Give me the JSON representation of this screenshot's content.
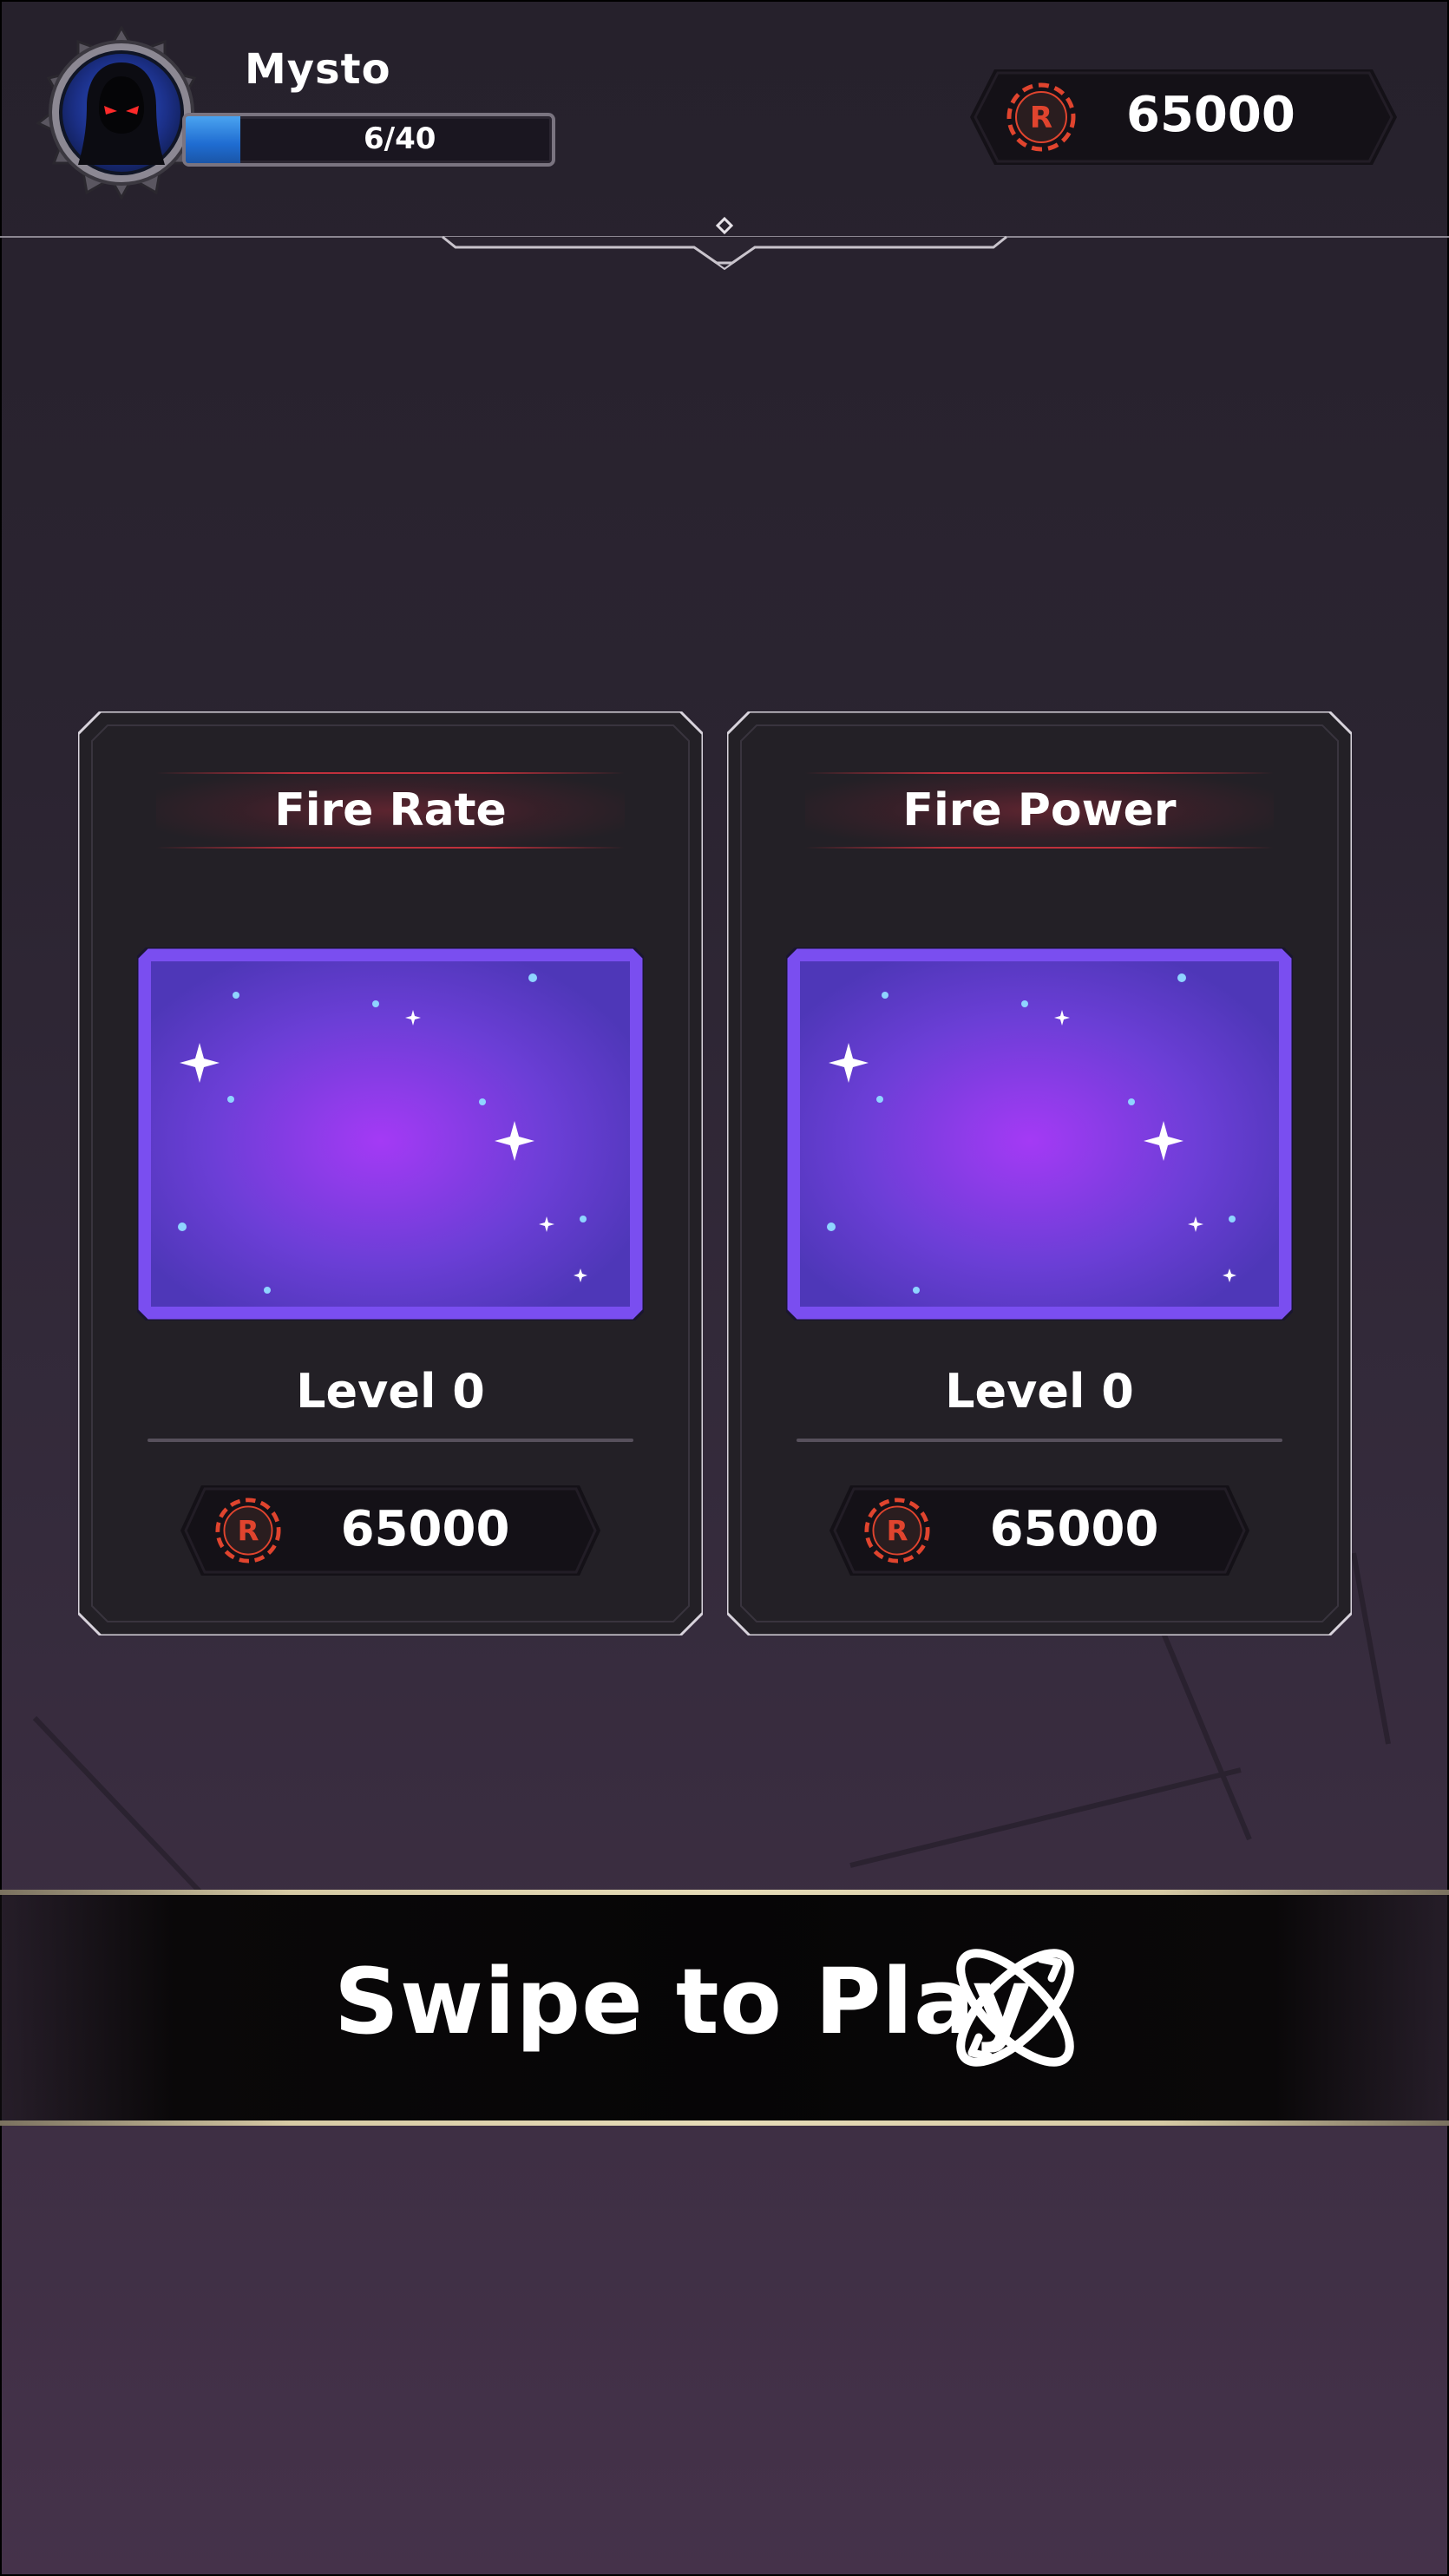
{
  "player": {
    "name": "Mysto",
    "xp_text": "6/40",
    "xp_fraction": 0.15
  },
  "currency": {
    "amount": "65000",
    "coin_letter": "R"
  },
  "upgrades": [
    {
      "title": "Fire Rate",
      "level": "Level 0",
      "cost": "65000"
    },
    {
      "title": "Fire Power",
      "level": "Level 0",
      "cost": "65000"
    }
  ],
  "play": {
    "label": "Swipe to Play"
  },
  "colors": {
    "accent_red": "#e0442e",
    "xp_blue": "#1f6cd1",
    "card_purple": "#7a3df0",
    "card_bg": "#232026"
  },
  "icons": {
    "avatar": "hooded-figure-icon",
    "coin": "r-coin-icon",
    "play": "orbit-swap-icon"
  }
}
